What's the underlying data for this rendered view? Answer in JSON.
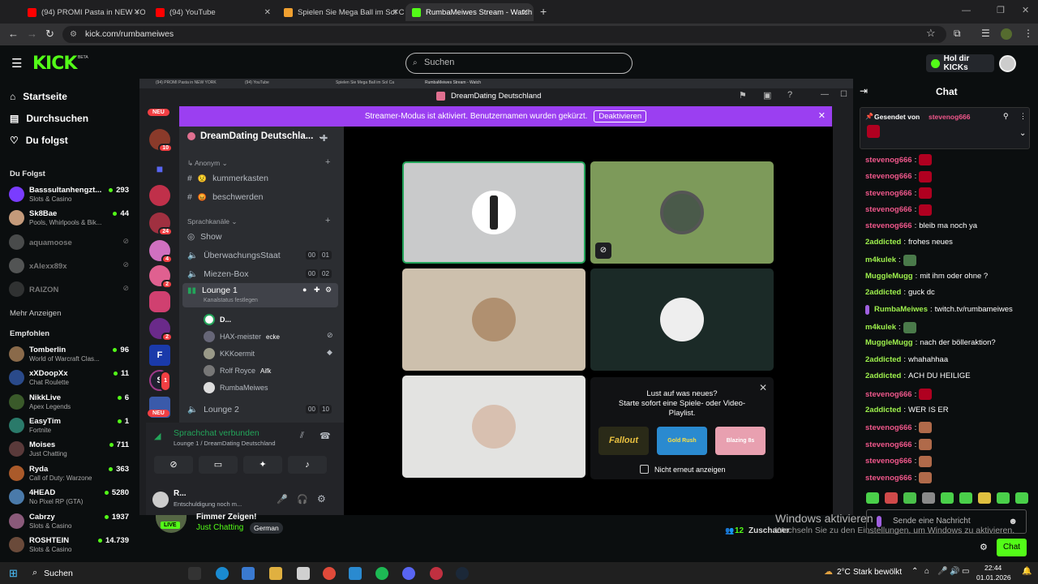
{
  "browser": {
    "tabs": [
      {
        "title": "(94) PROMI Pasta in NEW YORK",
        "color": "#ff0000"
      },
      {
        "title": "(94) YouTube",
        "color": "#ff0000"
      },
      {
        "title": "Spielen Sie Mega Ball im Sol Ca",
        "color": "#f0a030"
      },
      {
        "title": "RumbaMeiwes Stream - Watch",
        "color": "#53fc18"
      }
    ],
    "url": "kick.com/rumbameiwes",
    "new_tab": "+"
  },
  "kick": {
    "logo": "KICK",
    "beta": "BETA",
    "search_placeholder": "Suchen",
    "kicks_button": "Hol dir KICKs"
  },
  "sidebar": {
    "nav": [
      {
        "label": "Startseite",
        "icon": "home-icon"
      },
      {
        "label": "Durchsuchen",
        "icon": "browse-icon"
      },
      {
        "label": "Du folgst",
        "icon": "heart-icon"
      }
    ],
    "following_header": "Du Folgst",
    "following": [
      {
        "name": "Basssultanhengzt...",
        "cat": "Slots & Casino",
        "viewers": "293",
        "color": "#7a3cff"
      },
      {
        "name": "Sk8Bae",
        "cat": "Pools, Whirlpools & Bik...",
        "viewers": "44",
        "color": "#c49a7a"
      },
      {
        "name": "aquamoose",
        "offline": true,
        "color": "#888"
      },
      {
        "name": "xAlexx89x",
        "offline": true,
        "color": "#999"
      },
      {
        "name": "RAIZON",
        "offline": true,
        "color": "#555"
      }
    ],
    "more": "Mehr Anzeigen",
    "recommended_header": "Empfohlen",
    "recommended": [
      {
        "name": "Tomberlin",
        "cat": "World of Warcraft Clas...",
        "viewers": "96",
        "color": "#8a6a4a"
      },
      {
        "name": "xXDoopXx",
        "cat": "Chat Roulette",
        "viewers": "11",
        "color": "#2a4a8a"
      },
      {
        "name": "NikkLive",
        "cat": "Apex Legends",
        "viewers": "6",
        "color": "#3a5a2a"
      },
      {
        "name": "EasyTim",
        "cat": "Fortnite",
        "viewers": "1",
        "color": "#2a7a6a"
      },
      {
        "name": "Moises",
        "cat": "Just Chatting",
        "viewers": "711",
        "color": "#5a3a3a"
      },
      {
        "name": "Ryda",
        "cat": "Call of Duty: Warzone",
        "viewers": "363",
        "color": "#aa5a2a"
      },
      {
        "name": "4HEAD",
        "cat": "No Pixel RP (GTA)",
        "viewers": "5280",
        "color": "#4a7aaa"
      },
      {
        "name": "Cabrzy",
        "cat": "Slots & Casino",
        "viewers": "1937",
        "color": "#8a5a7a"
      },
      {
        "name": "ROSHTEIN",
        "cat": "Slots & Casino",
        "viewers": "14.739",
        "color": "#6a4a3a"
      }
    ]
  },
  "discord": {
    "tabs": [
      "(94) PROMI Pasta in NEW YORK",
      "(94) YouTube",
      "Spielen Sie Mega Ball im Sol Ca",
      "RumbaMeiwes Stream - Watch"
    ],
    "window_title": "DreamDating Deutschland",
    "banner_text": "Streamer-Modus ist aktiviert. Benutzernamen wurden gekürzt.",
    "banner_button": "Deaktivieren",
    "new_badge": "NEU",
    "guild_badges": [
      "10",
      "24",
      "4",
      "2",
      "2",
      "1"
    ],
    "server_name": "DreamDating Deutschla...",
    "category_anon": "Anonym",
    "channels": [
      "kummerkasten",
      "beschwerden"
    ],
    "voice_category": "Sprachkanäle",
    "voice": [
      {
        "name": "Show"
      },
      {
        "name": "ÜberwachungsStaat",
        "a": "00",
        "b": "01"
      },
      {
        "name": "Miezen-Box",
        "a": "00",
        "b": "02"
      },
      {
        "name": "Lounge 1",
        "status": "Kanalstatus festlegen"
      },
      {
        "name": "Lounge 2",
        "a": "00",
        "b": "10"
      }
    ],
    "lounge_users": [
      {
        "name": "D...",
        "tag": ""
      },
      {
        "name": "HAX-meister",
        "tag": "ecke"
      },
      {
        "name": "KKKoermit",
        "tag": ""
      },
      {
        "name": "Rolf Royce",
        "tag": "Aifk"
      },
      {
        "name": "RumbaMeiwes",
        "tag": ""
      }
    ],
    "vc_status": "Sprachchat verbunden",
    "vc_channel": "Lounge 1 / DreamDating Deutschland",
    "user_name": "R...",
    "user_status": "Entschuldigung noch m...",
    "promo_title": "Lust auf was neues?",
    "promo_text": "Starte sofort eine Spiele- oder Video-Playlist.",
    "promo_games": [
      "Fallout",
      "Gold Rush",
      "Blazing 8s"
    ],
    "promo_check": "Nicht erneut anzeigen"
  },
  "chat": {
    "title": "Chat",
    "pinned_by": "Gesendet von",
    "pinned_user": "stevenog666",
    "messages": [
      {
        "user": "stevenog666",
        "text": "",
        "emote": true
      },
      {
        "user": "stevenog666",
        "text": "",
        "emote": true
      },
      {
        "user": "stevenog666",
        "text": "",
        "emote": true
      },
      {
        "user": "stevenog666",
        "text": "",
        "emote": true
      },
      {
        "user": "stevenog666",
        "text": "bleib ma noch ya"
      },
      {
        "user": "2addicted",
        "text": "frohes neues"
      },
      {
        "user": "m4kulek",
        "text": "",
        "emote": true
      },
      {
        "user": "MuggleMugg",
        "text": "mit ihm oder ohne ?"
      },
      {
        "user": "2addicted",
        "text": "guck dc"
      },
      {
        "user": "RumbaMeiwes",
        "text": "twitch.tv/rumbameiwes"
      },
      {
        "user": "m4kulek",
        "text": "",
        "emote": true
      },
      {
        "user": "MuggleMugg",
        "text": "nach der bölleraktion?"
      },
      {
        "user": "2addicted",
        "text": "whahahhaa"
      },
      {
        "user": "2addicted",
        "text": "ACH DU HEILIGE"
      },
      {
        "user": "stevenog666",
        "text": "",
        "emote": true
      },
      {
        "user": "2addicted",
        "text": "WER IS ER"
      },
      {
        "user": "stevenog666",
        "text": "",
        "emote": true
      },
      {
        "user": "stevenog666",
        "text": "",
        "emote": true
      },
      {
        "user": "stevenog666",
        "text": "",
        "emote": true
      },
      {
        "user": "stevenog666",
        "text": "",
        "emote": true
      }
    ],
    "input_placeholder": "Sende eine Nachricht",
    "send": "Chat"
  },
  "stream": {
    "live": "LIVE",
    "title_partial": "Fimmer Zeigen!",
    "category": "Just Chatting",
    "language": "German",
    "viewers": "12",
    "viewers_label": "Zuschauer",
    "watermark1": "Windows aktivieren",
    "watermark2": "Wechseln Sie zu den Einstellungen, um Windows zu aktivieren."
  },
  "taskbar": {
    "search": "Suchen",
    "weather": "2°C",
    "weather_text": "Stark bewölkt",
    "time": "22:44",
    "date": "01.01.2026"
  }
}
